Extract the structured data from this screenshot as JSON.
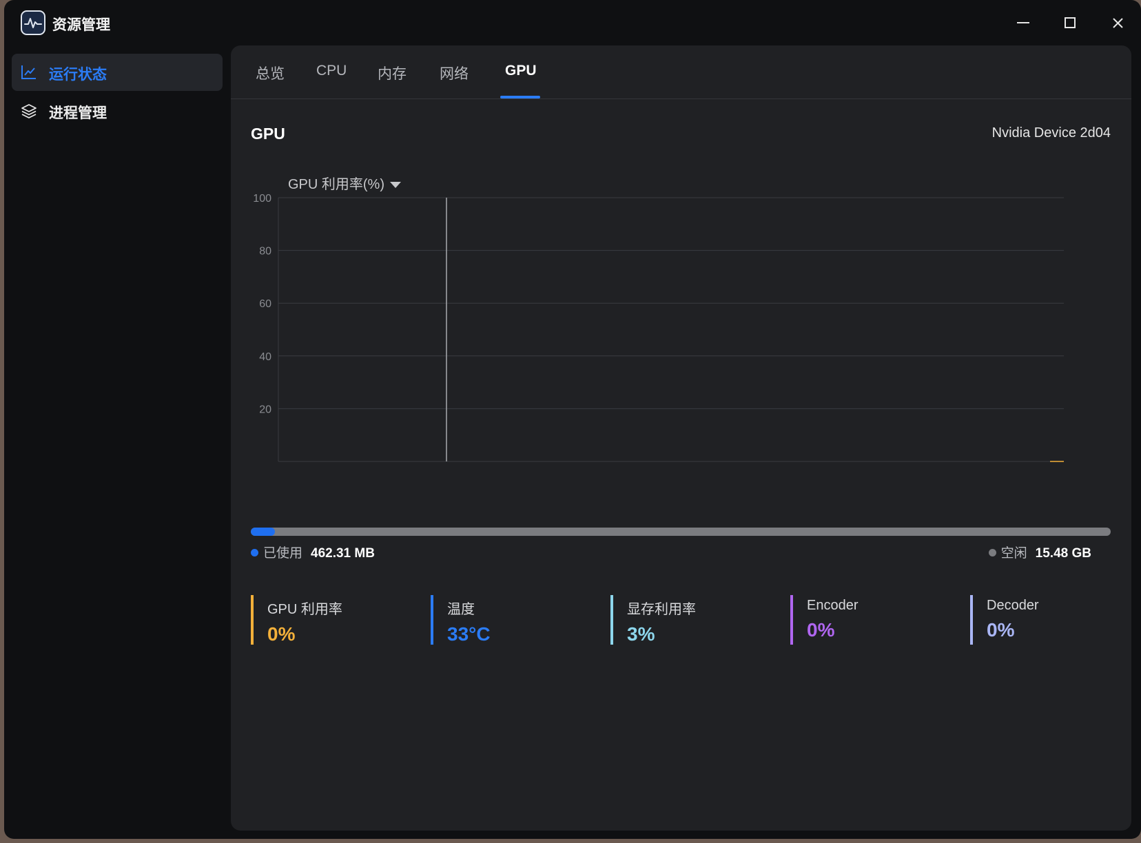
{
  "window": {
    "title": "资源管理"
  },
  "sidebar": {
    "items": [
      {
        "label": "运行状态",
        "icon": "line-chart-icon",
        "active": true
      },
      {
        "label": "进程管理",
        "icon": "layers-icon",
        "active": false
      }
    ]
  },
  "tabs": [
    {
      "label": "总览",
      "active": false
    },
    {
      "label": "CPU",
      "active": false
    },
    {
      "label": "内存",
      "active": false
    },
    {
      "label": "网络",
      "active": false
    },
    {
      "label": "GPU",
      "active": true
    }
  ],
  "gpu": {
    "title": "GPU",
    "device": "Nvidia Device 2d04",
    "metric_selector": "GPU 利用率(%)"
  },
  "chart_data": {
    "type": "line",
    "title": "",
    "ylabel": "",
    "xlabel": "",
    "ylim": [
      0,
      100
    ],
    "yticks": [
      "100",
      "80",
      "60",
      "40",
      "20"
    ],
    "series": [
      {
        "values": [
          0,
          0,
          0
        ],
        "color": "#f3b03a"
      }
    ],
    "grid": true
  },
  "memory": {
    "used_label": "已使用",
    "used_value": "462.31 MB",
    "free_label": "空闲",
    "free_value": "15.48 GB",
    "used_fraction": 0.028,
    "used_color": "#1f6ff0",
    "free_color": "#7b7c80"
  },
  "stats": [
    {
      "label": "GPU 利用率",
      "value": "0%",
      "color": "#f3b03a"
    },
    {
      "label": "温度",
      "value": "33°C",
      "color": "#2b7cf5"
    },
    {
      "label": "显存利用率",
      "value": "3%",
      "color": "#8dd6ec"
    },
    {
      "label": "Encoder",
      "value": "0%",
      "color": "#b066f0"
    },
    {
      "label": "Decoder",
      "value": "0%",
      "color": "#aab6f5"
    }
  ]
}
